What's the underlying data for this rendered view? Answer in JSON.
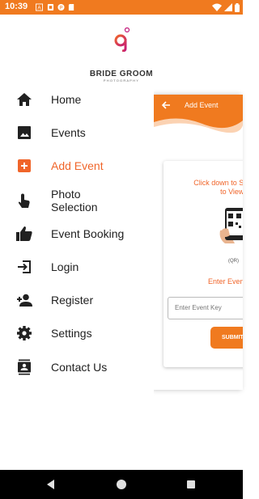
{
  "status_bar": {
    "time": "10:39",
    "background": "#f07a1f",
    "left_icons": [
      "notification-a-icon",
      "sim-icon",
      "app-icon",
      "sd-card-icon"
    ],
    "right_icons": [
      "wifi-icon",
      "signal-icon",
      "battery-icon"
    ]
  },
  "brand": {
    "name": "BRIDE GROOM",
    "sub": "PHOTOGRAPHY",
    "accent": "#f0652a"
  },
  "drawer": {
    "items": [
      {
        "label": "Home",
        "icon": "home-icon"
      },
      {
        "label": "Events",
        "icon": "image-icon"
      },
      {
        "label": "Add Event",
        "icon": "add-box-icon",
        "active": true
      },
      {
        "label": "Photo Selection",
        "icon": "touch-icon"
      },
      {
        "label": "Event Booking",
        "icon": "thumb-up-icon"
      },
      {
        "label": "Login",
        "icon": "login-icon"
      },
      {
        "label": "Register",
        "icon": "person-add-icon"
      },
      {
        "label": "Settings",
        "icon": "gear-icon"
      },
      {
        "label": "Contact Us",
        "icon": "contacts-icon"
      }
    ]
  },
  "content": {
    "title": "Add Event",
    "scan_line1": "Click down to Sca",
    "scan_line2": "to View E",
    "qr_label": "(QR)",
    "enter_label": "Enter Even",
    "input_placeholder": "Enter Event Key",
    "submit_label": "SUBMIT"
  },
  "nav_bar": {
    "buttons": [
      "back-icon",
      "home-circle-icon",
      "recents-icon"
    ]
  }
}
